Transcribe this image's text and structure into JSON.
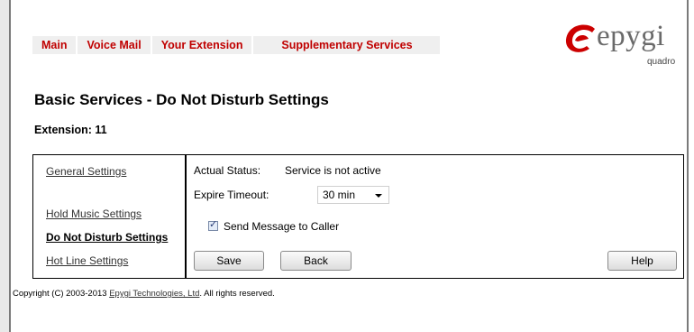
{
  "nav": {
    "main": "Main",
    "voice_mail": "Voice Mail",
    "your_extension": "Your Extension",
    "supplementary": "Supplementary Services"
  },
  "logo": {
    "brand": "epygi",
    "sub": "quadro",
    "brand_color": "#cc0000"
  },
  "page": {
    "title": "Basic Services - Do Not Disturb Settings",
    "extension": "Extension: 11"
  },
  "sidebar": {
    "items": [
      {
        "label": "General Settings",
        "active": false
      },
      {
        "label": "Hold Music Settings",
        "active": false
      },
      {
        "label": "Do Not Disturb Settings",
        "active": true
      },
      {
        "label": "Hot Line Settings",
        "active": false
      }
    ]
  },
  "form": {
    "status_label": "Actual Status:",
    "status_value": "Service is not active",
    "timeout_label": "Expire Timeout:",
    "timeout_value": "30 min",
    "send_message_label": "Send Message to Caller",
    "send_message_checked": true
  },
  "buttons": {
    "save": "Save",
    "back": "Back",
    "help": "Help"
  },
  "footer": {
    "prefix": "Copyright (C) 2003-2013 ",
    "link": "Epygi Technologies, Ltd",
    "suffix": ". All rights reserved."
  }
}
